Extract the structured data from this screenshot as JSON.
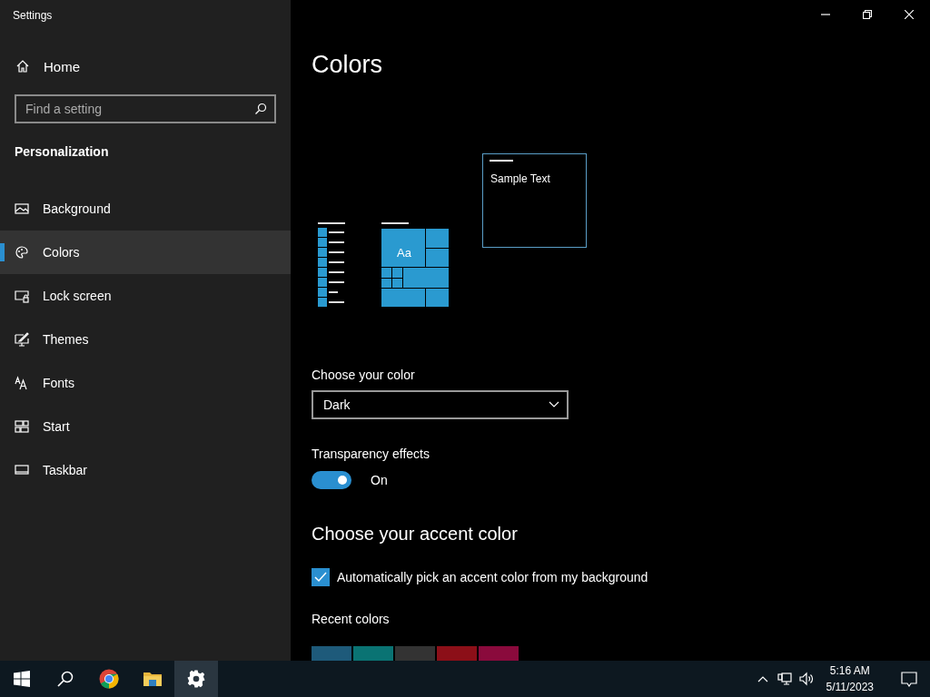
{
  "window": {
    "title": "Settings"
  },
  "sidebar": {
    "home": "Home",
    "search": {
      "placeholder": "Find a setting"
    },
    "section": "Personalization",
    "items": [
      {
        "label": "Background",
        "selected": false
      },
      {
        "label": "Colors",
        "selected": true
      },
      {
        "label": "Lock screen",
        "selected": false
      },
      {
        "label": "Themes",
        "selected": false
      },
      {
        "label": "Fonts",
        "selected": false
      },
      {
        "label": "Start",
        "selected": false
      },
      {
        "label": "Taskbar",
        "selected": false
      }
    ]
  },
  "main": {
    "title": "Colors",
    "preview": {
      "tile_text": "Aa",
      "sample_text": "Sample Text"
    },
    "color_mode": {
      "label": "Choose your color",
      "value": "Dark"
    },
    "transparency": {
      "label": "Transparency effects",
      "on": true,
      "state_text": "On"
    },
    "accent_heading": "Choose your accent color",
    "auto_accent": {
      "label": "Automatically pick an accent color from my background",
      "checked": true
    },
    "recent_colors": {
      "label": "Recent colors",
      "swatches": [
        {
          "color": "#1e5a7a"
        },
        {
          "color": "#0a7373"
        },
        {
          "color": "#333333"
        },
        {
          "color": "#8c0f18"
        },
        {
          "color": "#8a0a3c"
        }
      ]
    }
  },
  "taskbar": {
    "apps": [
      {
        "selected": false
      },
      {
        "selected": false
      },
      {
        "selected": true
      }
    ],
    "clock": {
      "time": "5:16 AM",
      "date": "5/11/2023"
    }
  }
}
